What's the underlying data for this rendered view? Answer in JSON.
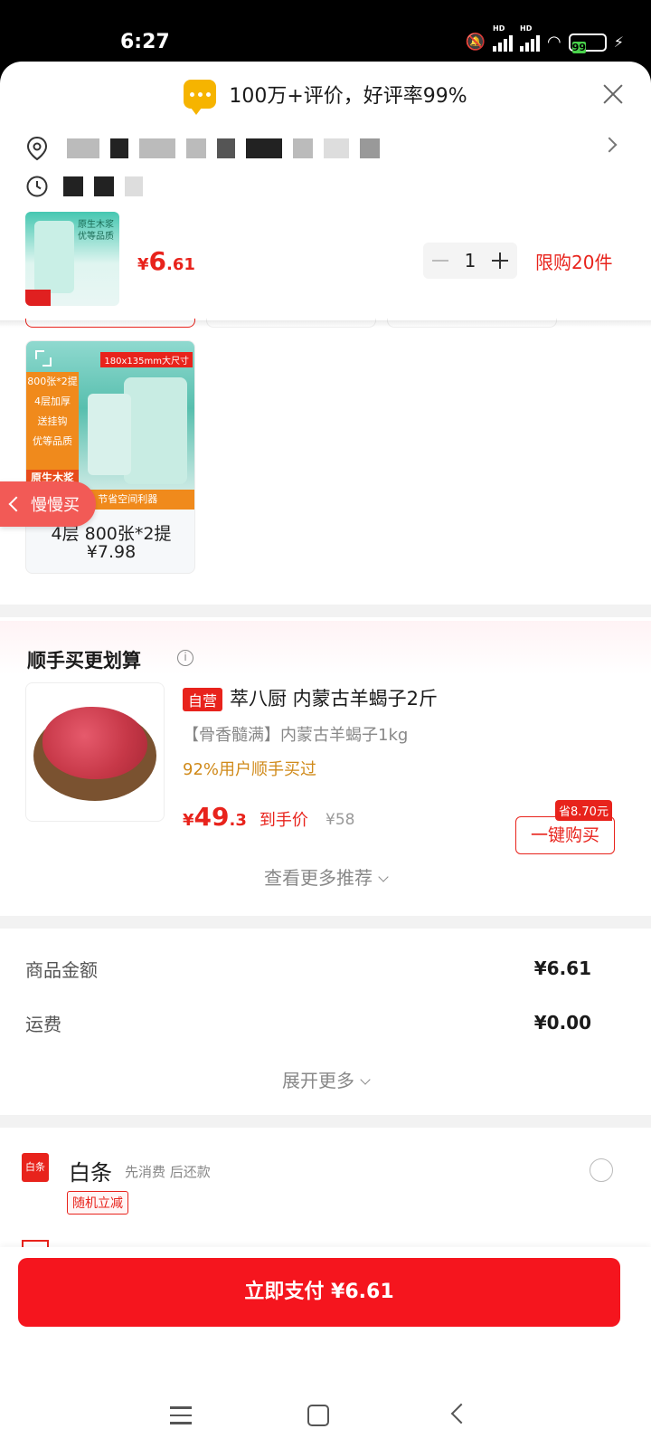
{
  "status_bar": {
    "time": "6:27",
    "battery": "99",
    "signal1_label": "HD",
    "signal2_label": "HD"
  },
  "header": {
    "title": "100万+评价，好评率99%"
  },
  "product": {
    "thumb_text": "原生木浆\n优等品质",
    "price_currency": "¥",
    "price_int": "6",
    "price_dec": ".61",
    "quantity": "1",
    "limit_text": "限购20件"
  },
  "spec_option": {
    "image_side_lines": [
      "800张*2提",
      "4层加厚",
      "送挂钩",
      "优等品质"
    ],
    "image_banner": "原生木浆",
    "image_top_badge": "180x135mm大尺寸",
    "image_bottom": "挂可挂 节省空间利器",
    "name": "4层 800张*2提",
    "price": "¥7.98"
  },
  "slow_buy": {
    "label": "慢慢买"
  },
  "addon": {
    "title": "顺手买更划算",
    "self_tag": "自营",
    "name": "萃八厨 内蒙古羊蝎子2斤",
    "subtitle": "【骨香髓满】内蒙古羊蝎子1kg",
    "percent_text": "92%用户顺手买过",
    "price_currency": "¥",
    "price_int": "49",
    "price_dec": ".3",
    "price_label": "到手价",
    "original_price": "¥58",
    "save_badge": "省8.70元",
    "buy_label": "一键购买",
    "more_label": "查看更多推荐"
  },
  "fees": {
    "rows": [
      {
        "label": "商品金额",
        "value": "¥6.61"
      },
      {
        "label": "运费",
        "value": "¥0.00"
      }
    ],
    "expand_label": "展开更多"
  },
  "payment": {
    "logo_text": "白条",
    "name": "白条",
    "desc": "先消费 后还款",
    "tag": "随机立减"
  },
  "bottom": {
    "pay_label": "立即支付 ¥6.61"
  },
  "colors": {
    "accent": "#e8231c",
    "pay_button": "#f5151e",
    "badge_yellow": "#f6b400"
  }
}
